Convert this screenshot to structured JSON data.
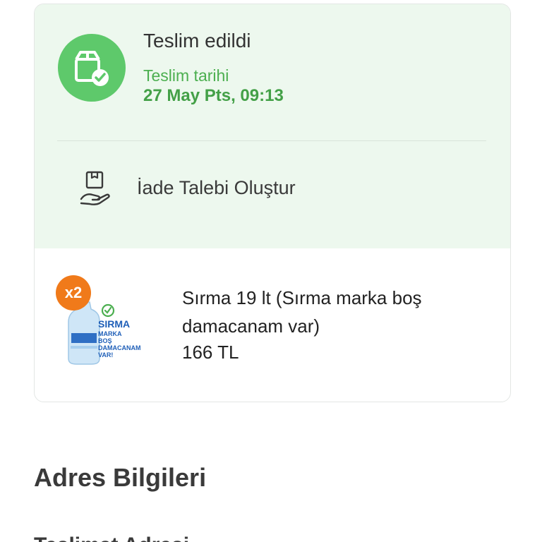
{
  "order_status": {
    "title": "Teslim edildi",
    "delivery_label": "Teslim tarihi",
    "delivery_date": "27 May Pts, 09:13",
    "icon": "delivered-box-icon",
    "accent_color": "#5ec96b",
    "background_color": "#edf8ee"
  },
  "return_action": {
    "label": "İade Talebi Oluştur",
    "icon": "return-box-hand-icon"
  },
  "product": {
    "quantity_badge": "x2",
    "name": "Sırma 19 lt (Sırma marka boş damacanam var)",
    "price": "166 TL",
    "image_text": {
      "brand": "SIRMA",
      "line1": "MARKA",
      "line2": "BOŞ",
      "line3": "DAMACANAM",
      "line4": "VAR!"
    },
    "badge_color": "#f07a1a"
  },
  "address_section": {
    "title": "Adres Bilgileri",
    "next_heading_partial": "Teslimat Adresi"
  }
}
